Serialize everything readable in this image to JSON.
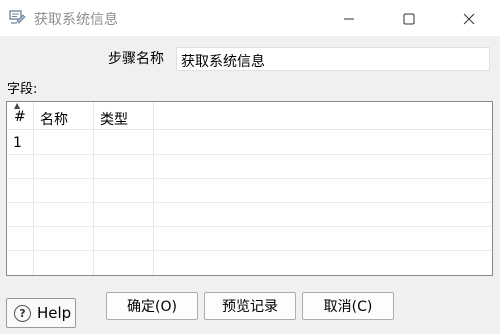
{
  "window": {
    "title": "获取系统信息"
  },
  "form": {
    "step_name_label": "步骤名称",
    "step_name_value": "获取系统信息",
    "fields_label": "字段:"
  },
  "table": {
    "columns": [
      "#",
      "名称",
      "类型"
    ],
    "rows": [
      {
        "num": "1",
        "name": "",
        "type": ""
      }
    ]
  },
  "buttons": {
    "help": "Help",
    "ok": "确定(O)",
    "preview": "预览记录",
    "cancel": "取消(C)"
  },
  "icons": [
    "app-icon",
    "minimize-icon",
    "maximize-icon",
    "close-icon",
    "help-icon",
    "sort-caret-icon"
  ]
}
